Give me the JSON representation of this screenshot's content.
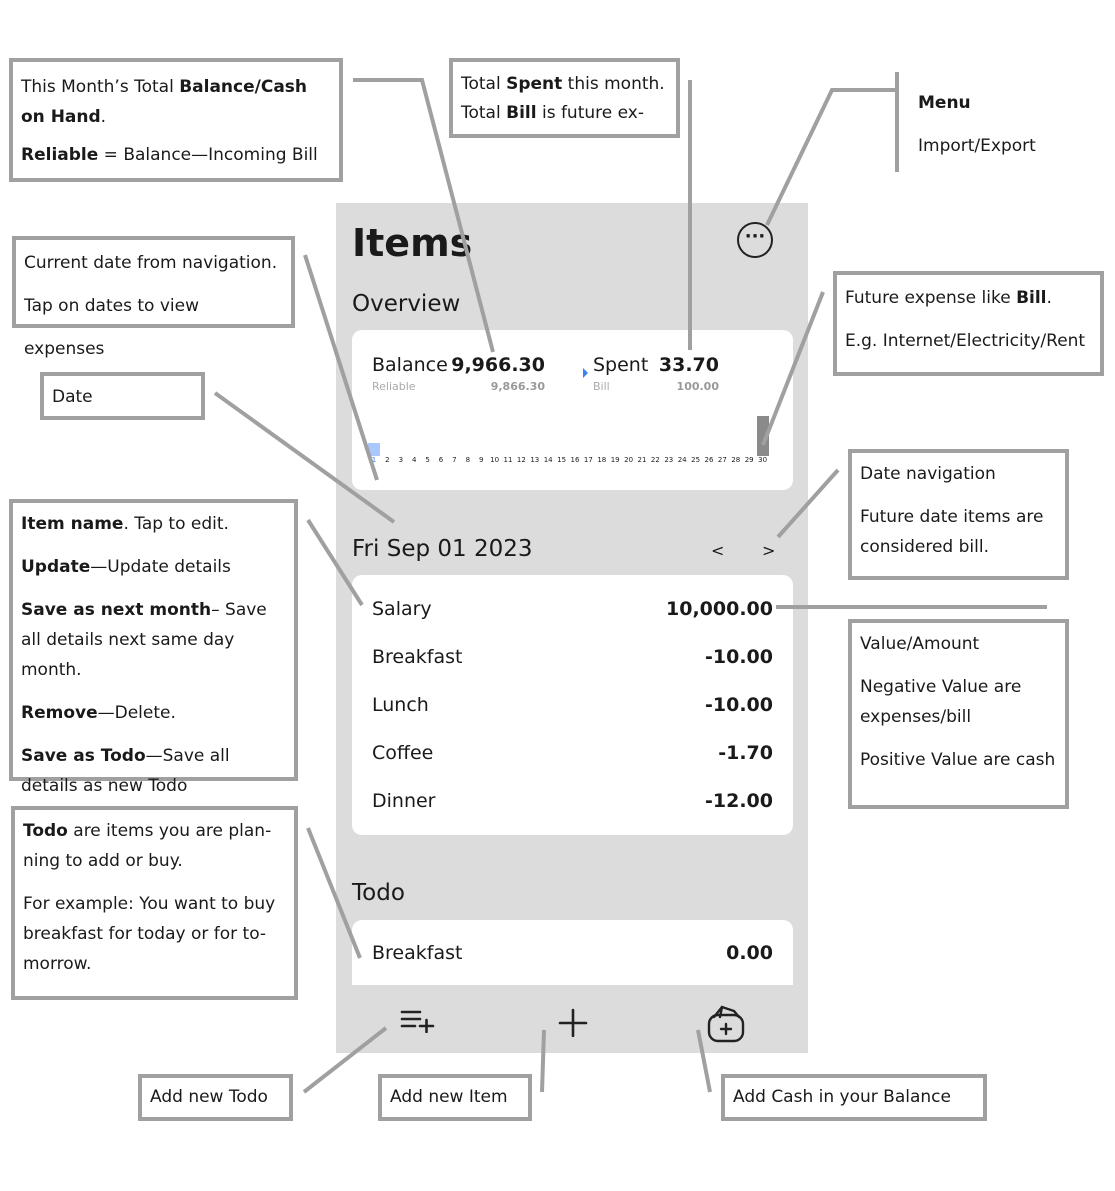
{
  "app": {
    "title": "Items",
    "menu_icon": "more-horizontal-icon"
  },
  "overview": {
    "title": "Overview",
    "balance_label": "Balance",
    "balance_value": "9,966.30",
    "reliable_label": "Reliable",
    "reliable_value": "9,866.30",
    "spent_label": "Spent",
    "spent_value": "33.70",
    "bill_label": "Bill",
    "bill_value": "100.00"
  },
  "chart_data": {
    "type": "bar",
    "categories": [
      "1",
      "2",
      "3",
      "4",
      "5",
      "6",
      "7",
      "8",
      "9",
      "10",
      "11",
      "12",
      "13",
      "14",
      "15",
      "16",
      "17",
      "18",
      "19",
      "20",
      "21",
      "22",
      "23",
      "24",
      "25",
      "26",
      "27",
      "28",
      "29",
      "30"
    ],
    "series": [
      {
        "values": [
          33.7,
          0,
          0,
          0,
          0,
          0,
          0,
          0,
          0,
          0,
          0,
          0,
          0,
          0,
          0,
          0,
          0,
          0,
          0,
          0,
          0,
          0,
          0,
          0,
          0,
          0,
          0,
          0,
          0,
          0
        ],
        "color": "#a9c8ff"
      },
      {
        "values": [
          0,
          0,
          0,
          0,
          0,
          0,
          0,
          0,
          0,
          0,
          0,
          0,
          0,
          0,
          0,
          0,
          0,
          0,
          0,
          0,
          0,
          0,
          0,
          0,
          0,
          0,
          0,
          0,
          0,
          100
        ],
        "color": "#8a8a8a"
      }
    ],
    "highlight_color": "#3b82f6"
  },
  "date": {
    "label": "Fri Sep 01 2023",
    "prev": "<",
    "next": ">"
  },
  "items": [
    {
      "name": "Salary",
      "value": "10,000.00"
    },
    {
      "name": "Breakfast",
      "value": "-10.00"
    },
    {
      "name": "Lunch",
      "value": "-10.00"
    },
    {
      "name": "Coffee",
      "value": "-1.70"
    },
    {
      "name": "Dinner",
      "value": "-12.00"
    }
  ],
  "todo": {
    "title": "Todo",
    "items": [
      {
        "name": "Breakfast",
        "value": "0.00"
      }
    ]
  },
  "bottom": {
    "add_todo_icon": "playlist-add-icon",
    "add_item_icon": "plus-icon",
    "add_cash_icon": "wallet-add-icon"
  },
  "notes": {
    "balance": [
      "This Month’s Total ",
      "Balance/Cash on Hand",
      ".",
      "Reliable",
      " = Balance—Incoming Bill"
    ],
    "spent": [
      "Total ",
      "Spent",
      " this month.",
      "Total ",
      "Bill",
      " is future ex-"
    ],
    "menu": [
      "Menu",
      "Import/Export"
    ],
    "current_date": [
      "Current date from navigation.",
      "Tap on dates to view expenses"
    ],
    "date": "Date",
    "future": [
      "Future expense like ",
      "Bill",
      ".",
      "E.g. Internet/Electricity/Rent"
    ],
    "date_nav": [
      "Date navigation",
      "Future date items are considered bill."
    ],
    "item": [
      "Item name",
      ". Tap to edit.",
      "Update",
      "—Update details",
      "Save as next month",
      "– Save all details next same day month.",
      "Remove",
      "—Delete.",
      "Save as Todo",
      "—Save all details as new Todo"
    ],
    "value": [
      "Value/Amount",
      "Negative Value are expenses/bill",
      "Positive Value are cash"
    ],
    "todo": [
      "Todo",
      " are items you are plan-ning to add or buy.",
      "For example: You want to buy breakfast for today or for to-morrow."
    ],
    "add_todo": "Add new Todo",
    "add_item": "Add new Item",
    "add_cash": "Add Cash in your Balance"
  }
}
